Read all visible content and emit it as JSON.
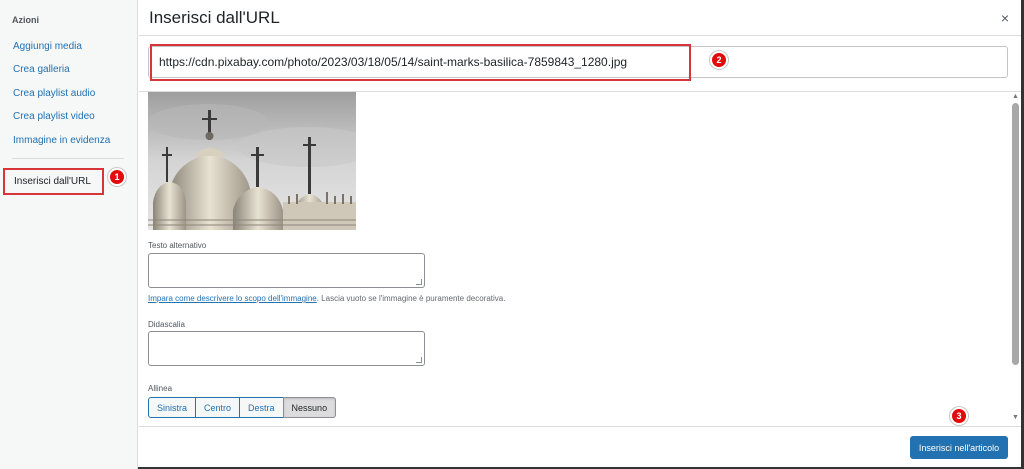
{
  "sidebar": {
    "heading": "Azioni",
    "items": [
      {
        "label": "Aggiungi media"
      },
      {
        "label": "Crea galleria"
      },
      {
        "label": "Crea playlist audio"
      },
      {
        "label": "Crea playlist video"
      },
      {
        "label": "Immagine in evidenza"
      }
    ],
    "active_item": "Inserisci dall'URL"
  },
  "header": {
    "title": "Inserisci dall'URL",
    "close_glyph": "×"
  },
  "url_input": {
    "value": "https://cdn.pixabay.com/photo/2023/03/18/05/14/saint-marks-basilica-7859843_1280.jpg"
  },
  "fields": {
    "alt_label": "Testo alternativo",
    "alt_value": "",
    "hint_link": "Impara come descrivere lo scopo dell'immagine",
    "hint_text": ". Lascia vuoto se l'immagine è puramente decorativa.",
    "caption_label": "Didascalia",
    "caption_value": "",
    "align_label": "Allinea"
  },
  "align_options": [
    "Sinistra",
    "Centro",
    "Destra",
    "Nessuno"
  ],
  "align_selected": "Nessuno",
  "footer": {
    "insert_label": "Inserisci nell'articolo"
  },
  "annotations": {
    "step1": "1",
    "step2": "2",
    "step3": "3"
  },
  "colors": {
    "accent": "#2271b1",
    "annotation_red": "#e20b0b"
  }
}
